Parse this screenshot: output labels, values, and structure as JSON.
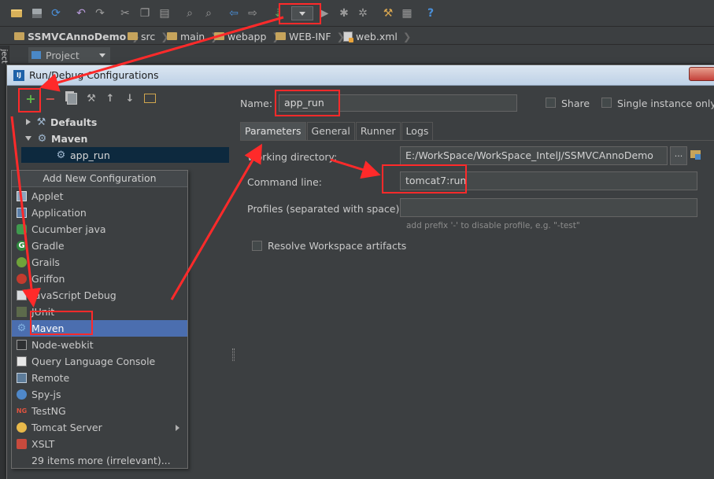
{
  "breadcrumb": {
    "project": "SSMVCAnnoDemo",
    "items": [
      "src",
      "main",
      "webapp",
      "WEB-INF",
      "web.xml"
    ]
  },
  "project_panel": {
    "sidetab_label": "ject",
    "dropdown_label": "Project"
  },
  "dialog": {
    "title": "Run/Debug Configurations",
    "tree": {
      "defaults": "Defaults",
      "maven": "Maven",
      "app_run": "app_run"
    },
    "popup": {
      "title": "Add New Configuration",
      "items": [
        {
          "label": "Applet",
          "icon": "applet-icon"
        },
        {
          "label": "Application",
          "icon": "application-icon"
        },
        {
          "label": "Cucumber java",
          "icon": "cucumber-icon"
        },
        {
          "label": "Gradle",
          "icon": "gradle-icon"
        },
        {
          "label": "Grails",
          "icon": "grails-icon"
        },
        {
          "label": "Griffon",
          "icon": "griffon-icon"
        },
        {
          "label": "JavaScript Debug",
          "icon": "javascript-debug-icon"
        },
        {
          "label": "JUnit",
          "icon": "junit-icon"
        },
        {
          "label": "Maven",
          "icon": "maven-icon",
          "selected": true
        },
        {
          "label": "Node-webkit",
          "icon": "node-webkit-icon"
        },
        {
          "label": "Query Language Console",
          "icon": "query-language-icon"
        },
        {
          "label": "Remote",
          "icon": "remote-icon"
        },
        {
          "label": "Spy-js",
          "icon": "spy-js-icon"
        },
        {
          "label": "TestNG",
          "icon": "testng-icon"
        },
        {
          "label": "Tomcat Server",
          "icon": "tomcat-icon",
          "submenu": true
        },
        {
          "label": "XSLT",
          "icon": "xslt-icon"
        },
        {
          "label": "29 items more (irrelevant)...",
          "icon": ""
        }
      ]
    },
    "name_label": "Name:",
    "name_value": "app_run",
    "share_label": "Share",
    "single_instance_label": "Single instance only",
    "tabs": [
      "Parameters",
      "General",
      "Runner",
      "Logs"
    ],
    "parameters": {
      "working_directory_label": "Working directory:",
      "working_directory_value": "E:/WorkSpace/WorkSpace_IntelJ/SSMVCAnnoDemo",
      "browse_label": "...",
      "command_line_label": "Command line:",
      "command_line_value": "tomcat7:run",
      "profiles_label": "Profiles (separated with space):",
      "profiles_value": "",
      "profiles_hint": "add prefix '-' to disable profile, e.g. \"-test\"",
      "resolve_label": "Resolve Workspace artifacts"
    }
  },
  "colors": {
    "background": "#3c3f41",
    "selection": "#4b6eaf",
    "tree_selection": "#0d293e",
    "annotation": "#ff2a2a",
    "add_green": "#5fb44a",
    "remove_red": "#d9534f"
  }
}
